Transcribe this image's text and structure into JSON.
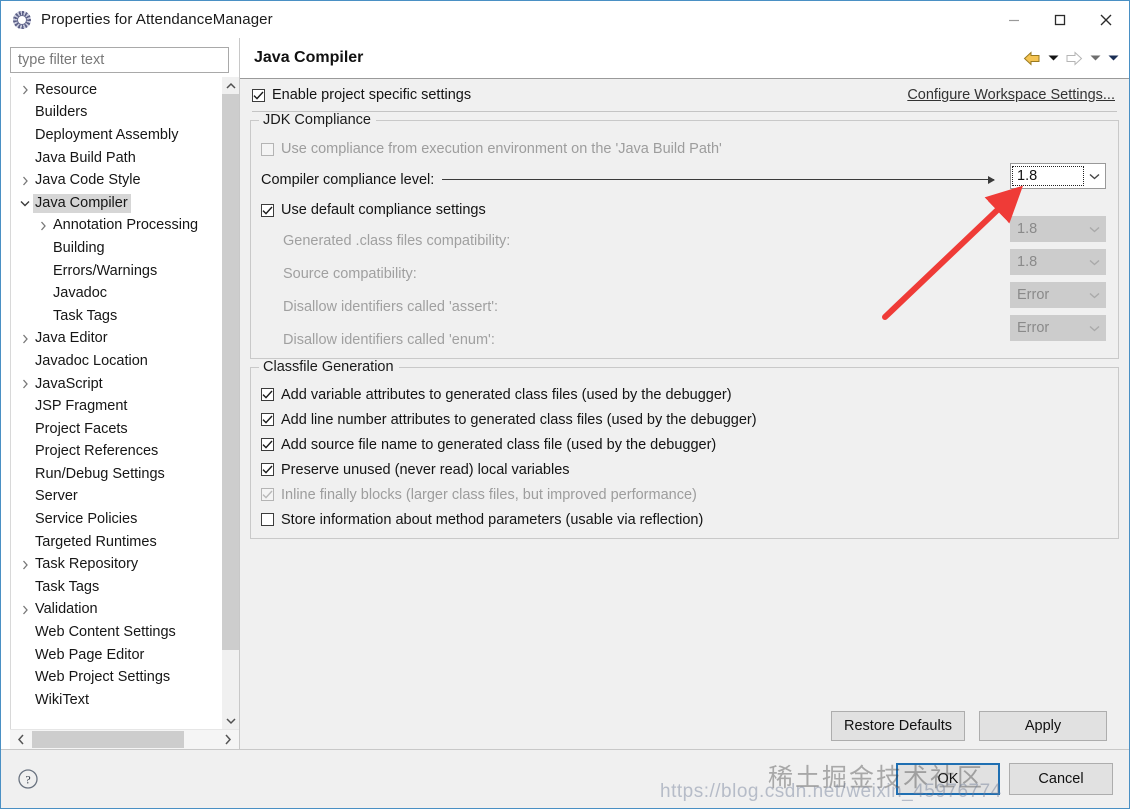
{
  "window": {
    "title": "Properties for AttendanceManager",
    "icon": "properties-gear-icon",
    "minimize_label": "Minimize",
    "maximize_label": "Maximize",
    "close_label": "Close"
  },
  "sidebar": {
    "filter": {
      "placeholder": "type filter text",
      "value": ""
    },
    "items": [
      {
        "label": "Resource",
        "expandable": true,
        "expanded": false,
        "indent": 0,
        "selected": false
      },
      {
        "label": "Builders",
        "expandable": false,
        "expanded": false,
        "indent": 0,
        "selected": false
      },
      {
        "label": "Deployment Assembly",
        "expandable": false,
        "expanded": false,
        "indent": 0,
        "selected": false
      },
      {
        "label": "Java Build Path",
        "expandable": false,
        "expanded": false,
        "indent": 0,
        "selected": false
      },
      {
        "label": "Java Code Style",
        "expandable": true,
        "expanded": false,
        "indent": 0,
        "selected": false
      },
      {
        "label": "Java Compiler",
        "expandable": true,
        "expanded": true,
        "indent": 0,
        "selected": true
      },
      {
        "label": "Annotation Processing",
        "expandable": true,
        "expanded": false,
        "indent": 1,
        "selected": false
      },
      {
        "label": "Building",
        "expandable": false,
        "expanded": false,
        "indent": 1,
        "selected": false
      },
      {
        "label": "Errors/Warnings",
        "expandable": false,
        "expanded": false,
        "indent": 1,
        "selected": false
      },
      {
        "label": "Javadoc",
        "expandable": false,
        "expanded": false,
        "indent": 1,
        "selected": false
      },
      {
        "label": "Task Tags",
        "expandable": false,
        "expanded": false,
        "indent": 1,
        "selected": false
      },
      {
        "label": "Java Editor",
        "expandable": true,
        "expanded": false,
        "indent": 0,
        "selected": false
      },
      {
        "label": "Javadoc Location",
        "expandable": false,
        "expanded": false,
        "indent": 0,
        "selected": false
      },
      {
        "label": "JavaScript",
        "expandable": true,
        "expanded": false,
        "indent": 0,
        "selected": false
      },
      {
        "label": "JSP Fragment",
        "expandable": false,
        "expanded": false,
        "indent": 0,
        "selected": false
      },
      {
        "label": "Project Facets",
        "expandable": false,
        "expanded": false,
        "indent": 0,
        "selected": false
      },
      {
        "label": "Project References",
        "expandable": false,
        "expanded": false,
        "indent": 0,
        "selected": false
      },
      {
        "label": "Run/Debug Settings",
        "expandable": false,
        "expanded": false,
        "indent": 0,
        "selected": false
      },
      {
        "label": "Server",
        "expandable": false,
        "expanded": false,
        "indent": 0,
        "selected": false
      },
      {
        "label": "Service Policies",
        "expandable": false,
        "expanded": false,
        "indent": 0,
        "selected": false
      },
      {
        "label": "Targeted Runtimes",
        "expandable": false,
        "expanded": false,
        "indent": 0,
        "selected": false
      },
      {
        "label": "Task Repository",
        "expandable": true,
        "expanded": false,
        "indent": 0,
        "selected": false
      },
      {
        "label": "Task Tags",
        "expandable": false,
        "expanded": false,
        "indent": 0,
        "selected": false
      },
      {
        "label": "Validation",
        "expandable": true,
        "expanded": false,
        "indent": 0,
        "selected": false
      },
      {
        "label": "Web Content Settings",
        "expandable": false,
        "expanded": false,
        "indent": 0,
        "selected": false
      },
      {
        "label": "Web Page Editor",
        "expandable": false,
        "expanded": false,
        "indent": 0,
        "selected": false
      },
      {
        "label": "Web Project Settings",
        "expandable": false,
        "expanded": false,
        "indent": 0,
        "selected": false
      },
      {
        "label": "WikiText",
        "expandable": false,
        "expanded": false,
        "indent": 0,
        "selected": false
      }
    ]
  },
  "page": {
    "title": "Java Compiler",
    "nav": {
      "back_icon": "back-arrow-icon",
      "back_caret_icon": "chevron-down-icon",
      "forward_icon": "forward-arrow-icon",
      "forward_caret_icon": "chevron-down-icon",
      "menu_caret_icon": "chevron-down-icon"
    },
    "enable_project_specific": {
      "label": "Enable project specific settings",
      "checked": true,
      "enabled": true
    },
    "configure_workspace_link": "Configure Workspace Settings...",
    "jdk_compliance": {
      "legend": "JDK Compliance",
      "use_execution_env": {
        "label": "Use compliance from execution environment on the 'Java Build Path'",
        "label_plain": "Use compliance from execution environment on the ",
        "link_text": "'Java Build Path'",
        "checked": false,
        "enabled": false
      },
      "compliance_level": {
        "label": "Compiler compliance level:",
        "value": "1.8",
        "enabled": true,
        "focused": true
      },
      "use_default_compliance": {
        "label": "Use default compliance settings",
        "checked": true,
        "enabled": true
      },
      "rows": [
        {
          "label": "Generated .class files compatibility:",
          "value": "1.8",
          "enabled": false
        },
        {
          "label": "Source compatibility:",
          "value": "1.8",
          "enabled": false
        },
        {
          "label": "Disallow identifiers called 'assert':",
          "value": "Error",
          "enabled": false
        },
        {
          "label": "Disallow identifiers called 'enum':",
          "value": "Error",
          "enabled": false
        }
      ]
    },
    "classfile_generation": {
      "legend": "Classfile Generation",
      "options": [
        {
          "label": "Add variable attributes to generated class files (used by the debugger)",
          "checked": true,
          "enabled": true
        },
        {
          "label": "Add line number attributes to generated class files (used by the debugger)",
          "checked": true,
          "enabled": true
        },
        {
          "label": "Add source file name to generated class file (used by the debugger)",
          "checked": true,
          "enabled": true
        },
        {
          "label": "Preserve unused (never read) local variables",
          "checked": true,
          "enabled": true
        },
        {
          "label": "Inline finally blocks (larger class files, but improved performance)",
          "checked": true,
          "enabled": false
        },
        {
          "label": "Store information about method parameters (usable via reflection)",
          "checked": false,
          "enabled": true
        }
      ]
    },
    "restore_defaults_label": "Restore Defaults",
    "apply_label": "Apply"
  },
  "footer": {
    "help_icon": "help-question-icon",
    "ok_label": "OK",
    "cancel_label": "Cancel"
  },
  "annotation": {
    "arrow_color": "#ef3b37",
    "description": "red arrow pointing to compiler compliance level dropdown"
  },
  "watermark": {
    "text_cn": "稀土掘金技术社区",
    "text_url": "https://blog.csdn.net/weixin_45976774"
  },
  "colors": {
    "window_border": "#4a90c4",
    "panel_background": "#f0f0f0",
    "selection": "#d6d6d6",
    "ok_focus_border": "#1f6fb2",
    "annotation_red": "#ef3b37"
  }
}
